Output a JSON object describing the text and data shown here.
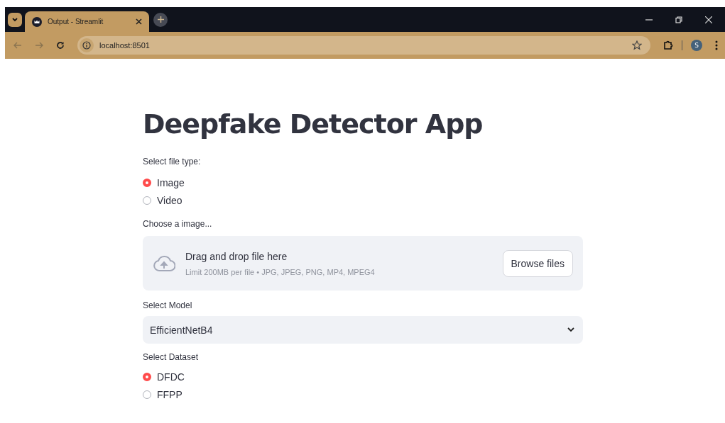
{
  "browser": {
    "tab_title": "Output - Streamlit",
    "address": "localhost:8501",
    "profile_initial": "S"
  },
  "page": {
    "title": "Deepfake Detector App",
    "file_type": {
      "label": "Select file type:",
      "options": [
        {
          "label": "Image",
          "selected": true
        },
        {
          "label": "Video",
          "selected": false
        }
      ]
    },
    "uploader": {
      "label": "Choose a image...",
      "instruction": "Drag and drop file here",
      "limit": "Limit 200MB per file • JPG, JPEG, PNG, MP4, MPEG4",
      "button": "Browse files"
    },
    "model": {
      "label": "Select Model",
      "value": "EfficientNetB4"
    },
    "dataset": {
      "label": "Select Dataset",
      "options": [
        {
          "label": "DFDC",
          "selected": true
        },
        {
          "label": "FFPP",
          "selected": false
        }
      ]
    }
  }
}
